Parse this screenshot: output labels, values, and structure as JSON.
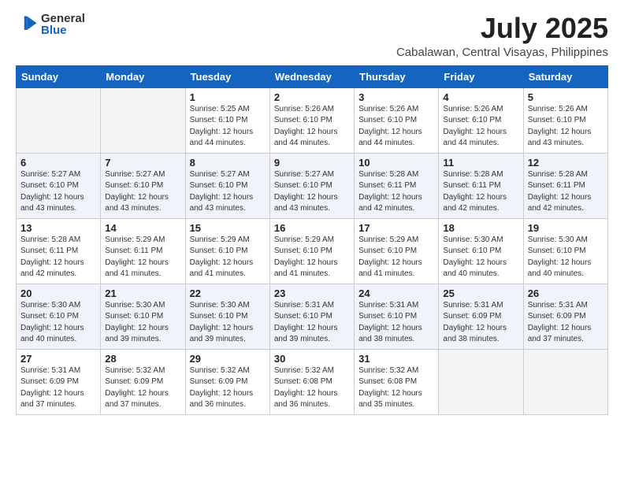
{
  "logo": {
    "general": "General",
    "blue": "Blue"
  },
  "title": "July 2025",
  "location": "Cabalawan, Central Visayas, Philippines",
  "days_of_week": [
    "Sunday",
    "Monday",
    "Tuesday",
    "Wednesday",
    "Thursday",
    "Friday",
    "Saturday"
  ],
  "weeks": [
    [
      {
        "num": "",
        "info": ""
      },
      {
        "num": "",
        "info": ""
      },
      {
        "num": "1",
        "info": "Sunrise: 5:25 AM\nSunset: 6:10 PM\nDaylight: 12 hours and 44 minutes."
      },
      {
        "num": "2",
        "info": "Sunrise: 5:26 AM\nSunset: 6:10 PM\nDaylight: 12 hours and 44 minutes."
      },
      {
        "num": "3",
        "info": "Sunrise: 5:26 AM\nSunset: 6:10 PM\nDaylight: 12 hours and 44 minutes."
      },
      {
        "num": "4",
        "info": "Sunrise: 5:26 AM\nSunset: 6:10 PM\nDaylight: 12 hours and 44 minutes."
      },
      {
        "num": "5",
        "info": "Sunrise: 5:26 AM\nSunset: 6:10 PM\nDaylight: 12 hours and 43 minutes."
      }
    ],
    [
      {
        "num": "6",
        "info": "Sunrise: 5:27 AM\nSunset: 6:10 PM\nDaylight: 12 hours and 43 minutes."
      },
      {
        "num": "7",
        "info": "Sunrise: 5:27 AM\nSunset: 6:10 PM\nDaylight: 12 hours and 43 minutes."
      },
      {
        "num": "8",
        "info": "Sunrise: 5:27 AM\nSunset: 6:10 PM\nDaylight: 12 hours and 43 minutes."
      },
      {
        "num": "9",
        "info": "Sunrise: 5:27 AM\nSunset: 6:10 PM\nDaylight: 12 hours and 43 minutes."
      },
      {
        "num": "10",
        "info": "Sunrise: 5:28 AM\nSunset: 6:11 PM\nDaylight: 12 hours and 42 minutes."
      },
      {
        "num": "11",
        "info": "Sunrise: 5:28 AM\nSunset: 6:11 PM\nDaylight: 12 hours and 42 minutes."
      },
      {
        "num": "12",
        "info": "Sunrise: 5:28 AM\nSunset: 6:11 PM\nDaylight: 12 hours and 42 minutes."
      }
    ],
    [
      {
        "num": "13",
        "info": "Sunrise: 5:28 AM\nSunset: 6:11 PM\nDaylight: 12 hours and 42 minutes."
      },
      {
        "num": "14",
        "info": "Sunrise: 5:29 AM\nSunset: 6:11 PM\nDaylight: 12 hours and 41 minutes."
      },
      {
        "num": "15",
        "info": "Sunrise: 5:29 AM\nSunset: 6:10 PM\nDaylight: 12 hours and 41 minutes."
      },
      {
        "num": "16",
        "info": "Sunrise: 5:29 AM\nSunset: 6:10 PM\nDaylight: 12 hours and 41 minutes."
      },
      {
        "num": "17",
        "info": "Sunrise: 5:29 AM\nSunset: 6:10 PM\nDaylight: 12 hours and 41 minutes."
      },
      {
        "num": "18",
        "info": "Sunrise: 5:30 AM\nSunset: 6:10 PM\nDaylight: 12 hours and 40 minutes."
      },
      {
        "num": "19",
        "info": "Sunrise: 5:30 AM\nSunset: 6:10 PM\nDaylight: 12 hours and 40 minutes."
      }
    ],
    [
      {
        "num": "20",
        "info": "Sunrise: 5:30 AM\nSunset: 6:10 PM\nDaylight: 12 hours and 40 minutes."
      },
      {
        "num": "21",
        "info": "Sunrise: 5:30 AM\nSunset: 6:10 PM\nDaylight: 12 hours and 39 minutes."
      },
      {
        "num": "22",
        "info": "Sunrise: 5:30 AM\nSunset: 6:10 PM\nDaylight: 12 hours and 39 minutes."
      },
      {
        "num": "23",
        "info": "Sunrise: 5:31 AM\nSunset: 6:10 PM\nDaylight: 12 hours and 39 minutes."
      },
      {
        "num": "24",
        "info": "Sunrise: 5:31 AM\nSunset: 6:10 PM\nDaylight: 12 hours and 38 minutes."
      },
      {
        "num": "25",
        "info": "Sunrise: 5:31 AM\nSunset: 6:09 PM\nDaylight: 12 hours and 38 minutes."
      },
      {
        "num": "26",
        "info": "Sunrise: 5:31 AM\nSunset: 6:09 PM\nDaylight: 12 hours and 37 minutes."
      }
    ],
    [
      {
        "num": "27",
        "info": "Sunrise: 5:31 AM\nSunset: 6:09 PM\nDaylight: 12 hours and 37 minutes."
      },
      {
        "num": "28",
        "info": "Sunrise: 5:32 AM\nSunset: 6:09 PM\nDaylight: 12 hours and 37 minutes."
      },
      {
        "num": "29",
        "info": "Sunrise: 5:32 AM\nSunset: 6:09 PM\nDaylight: 12 hours and 36 minutes."
      },
      {
        "num": "30",
        "info": "Sunrise: 5:32 AM\nSunset: 6:08 PM\nDaylight: 12 hours and 36 minutes."
      },
      {
        "num": "31",
        "info": "Sunrise: 5:32 AM\nSunset: 6:08 PM\nDaylight: 12 hours and 35 minutes."
      },
      {
        "num": "",
        "info": ""
      },
      {
        "num": "",
        "info": ""
      }
    ]
  ]
}
